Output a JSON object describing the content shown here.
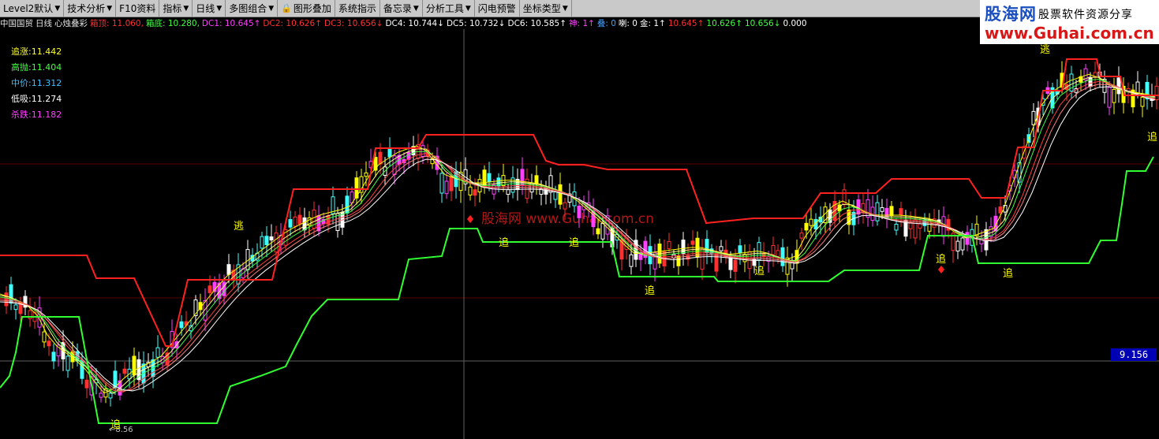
{
  "toolbar": {
    "items": [
      {
        "label": "Level2默认",
        "arrow": true
      },
      {
        "label": "技术分析",
        "arrow": true
      },
      {
        "label": "F10资料",
        "arrow": false
      },
      {
        "label": "指标",
        "arrow": true
      },
      {
        "label": "日线",
        "arrow": true
      },
      {
        "label": "多图组合",
        "arrow": true
      },
      {
        "label": "图形叠加",
        "arrow": false,
        "lock": true
      },
      {
        "label": "系统指示",
        "arrow": false
      },
      {
        "label": "备忘录",
        "arrow": true
      },
      {
        "label": "分析工具",
        "arrow": true
      },
      {
        "label": "闪电预警",
        "arrow": false
      },
      {
        "label": "坐标类型",
        "arrow": true
      }
    ],
    "arrow_icon": "▼",
    "lock_icon": "🔒"
  },
  "logo": {
    "brand": "股海网",
    "slogan": "股票软件资源分享",
    "url": "www.Guhai.com.cn"
  },
  "infobar": {
    "items": [
      {
        "text": "中国国贸",
        "color": "#e0e0e0"
      },
      {
        "text": "日线",
        "color": "#e0e0e0"
      },
      {
        "text": "心烛叠彩",
        "color": "#e0e0e0"
      },
      {
        "text": "箱顶: 11.060,",
        "color": "#ff3030"
      },
      {
        "text": "箱底: 10.280,",
        "color": "#40ff40"
      },
      {
        "text": "DC1: 10.645↑",
        "color": "#ff40ff"
      },
      {
        "text": "DC2: 10.626↑",
        "color": "#ff3030"
      },
      {
        "text": "DC3: 10.656↓",
        "color": "#ff3030"
      },
      {
        "text": "DC4: 10.744↓",
        "color": "#ffffff"
      },
      {
        "text": "DC5: 10.732↓",
        "color": "#ffffff"
      },
      {
        "text": "DC6: 10.585↑",
        "color": "#ffffff"
      },
      {
        "text": "神: 1↑",
        "color": "#ff40ff"
      },
      {
        "text": "叠: 0",
        "color": "#40a0ff"
      },
      {
        "text": "喇: 0",
        "color": "#ffffff"
      },
      {
        "text": "金: 1↑",
        "color": "#ffffff"
      },
      {
        "text": "10.645↑",
        "color": "#ff3030"
      },
      {
        "text": "10.626↑",
        "color": "#40ff40"
      },
      {
        "text": "10.656↓",
        "color": "#40ff40"
      },
      {
        "text": "0.000",
        "color": "#ffffff"
      }
    ]
  },
  "legend": [
    {
      "label": "追涨",
      "value": "11.442",
      "color": "#ffff30"
    },
    {
      "label": "高抛",
      "value": "11.404",
      "color": "#40ff40"
    },
    {
      "label": "中价",
      "value": "11.312",
      "color": "#40c0ff"
    },
    {
      "label": "低吸",
      "value": "11.274",
      "color": "#ffffff"
    },
    {
      "label": "杀跌",
      "value": "11.182",
      "color": "#ff40ff"
    }
  ],
  "price_marker": "9.156",
  "low_label": "8.56",
  "watermark": "股海网 www.Guhai.com.cn",
  "signals": [
    {
      "text": "逃"
    },
    {
      "text": "追"
    },
    {
      "text": "追"
    },
    {
      "text": "追"
    },
    {
      "text": "追"
    },
    {
      "text": "追"
    },
    {
      "text": "追"
    },
    {
      "text": "追"
    },
    {
      "text": "逃"
    },
    {
      "text": "追"
    }
  ],
  "colors": {
    "box_top": "#ff2020",
    "box_bottom": "#30ff30",
    "up_candle": "#ff40ff",
    "down_candle": "#40ffff",
    "yellow": "#ffff00"
  }
}
